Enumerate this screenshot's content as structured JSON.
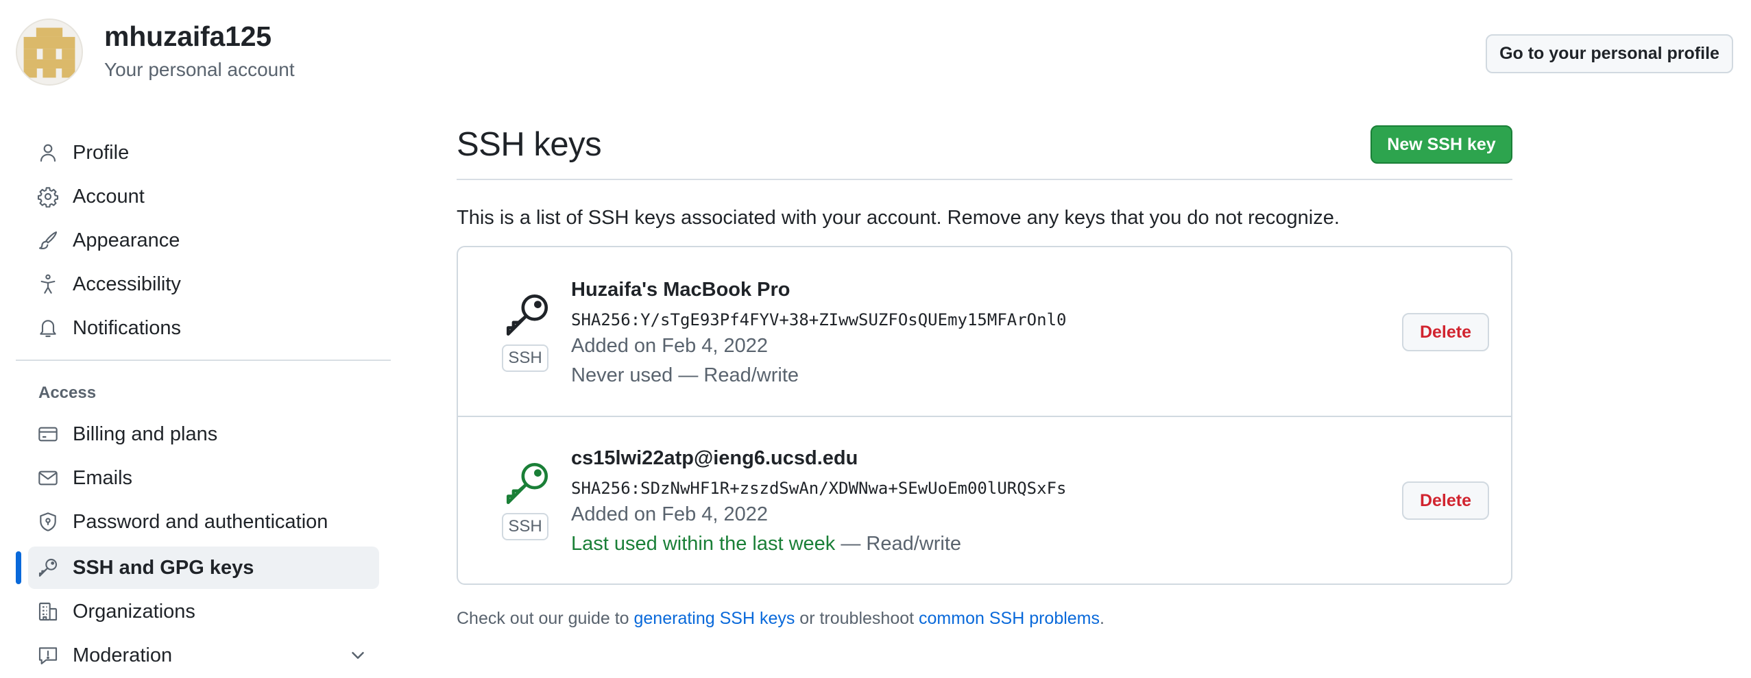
{
  "header": {
    "username": "mhuzaifa125",
    "account_type": "Your personal account",
    "profile_button": "Go to your personal profile"
  },
  "sidebar": {
    "items": [
      {
        "label": "Profile",
        "icon": "person-icon"
      },
      {
        "label": "Account",
        "icon": "gear-icon"
      },
      {
        "label": "Appearance",
        "icon": "paintbrush-icon"
      },
      {
        "label": "Accessibility",
        "icon": "accessibility-icon"
      },
      {
        "label": "Notifications",
        "icon": "bell-icon"
      }
    ],
    "access_title": "Access",
    "access_items": [
      {
        "label": "Billing and plans",
        "icon": "credit-card-icon"
      },
      {
        "label": "Emails",
        "icon": "mail-icon"
      },
      {
        "label": "Password and authentication",
        "icon": "shield-lock-icon"
      },
      {
        "label": "SSH and GPG keys",
        "icon": "key-icon",
        "active": true
      },
      {
        "label": "Organizations",
        "icon": "organization-icon"
      },
      {
        "label": "Moderation",
        "icon": "report-icon",
        "expandable": true
      }
    ]
  },
  "main": {
    "title": "SSH keys",
    "new_button": "New SSH key",
    "description": "This is a list of SSH keys associated with your account. Remove any keys that you do not recognize.",
    "keys": [
      {
        "title": "Huzaifa's MacBook Pro",
        "fingerprint": "SHA256:Y/sTgE93Pf4FYV+38+ZIwwSUZFOsQUEmy15MFArOnl0",
        "added": "Added on Feb 4, 2022",
        "usage": "Never used — Read/write",
        "badge": "SSH",
        "delete_label": "Delete",
        "icon_color": "#1f2328"
      },
      {
        "title": "cs15lwi22atp@ieng6.ucsd.edu",
        "fingerprint": "SHA256:SDzNwHF1R+zszdSwAn/XDWNwa+SEwUoEm00lURQSxFs",
        "added": "Added on Feb 4, 2022",
        "usage_recent": "Last used within the last week",
        "usage_rest": " — Read/write",
        "badge": "SSH",
        "delete_label": "Delete",
        "icon_color": "#1a7f37"
      }
    ],
    "footer": {
      "prefix": "Check out our guide to ",
      "link1": "generating SSH keys",
      "middle": " or troubleshoot ",
      "link2": "common SSH problems",
      "suffix": "."
    }
  },
  "colors": {
    "accent": "#0969da",
    "primary_button": "#2da44e",
    "danger": "#d1242f",
    "success": "#1a7f37"
  }
}
